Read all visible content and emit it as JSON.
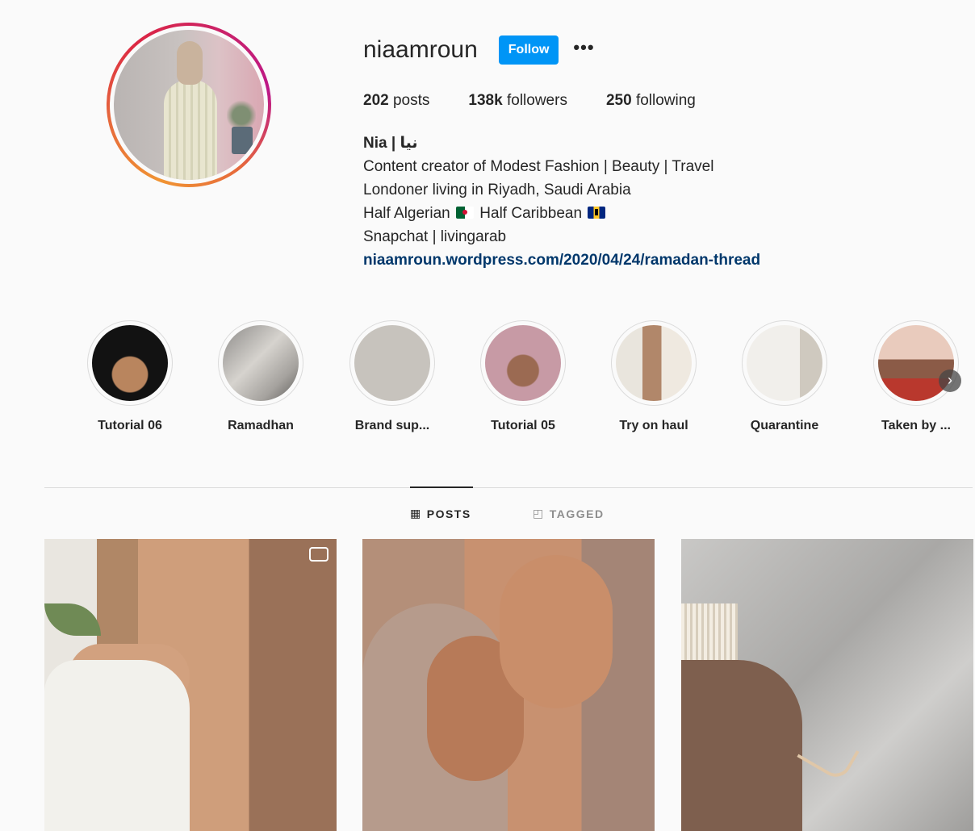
{
  "profile": {
    "username": "niaamroun",
    "follow_label": "Follow",
    "more_label": "•••",
    "stats": {
      "posts_count": "202",
      "posts_label": "posts",
      "followers_count": "138k",
      "followers_label": "followers",
      "following_count": "250",
      "following_label": "following"
    },
    "bio": {
      "name": "Nia | نيا",
      "line1": "Content creator of Modest Fashion | Beauty | Travel",
      "line2": "Londoner living in Riyadh, Saudi Arabia",
      "line3_a": "Half Algerian",
      "line3_b": "Half Caribbean",
      "line4": "Snapchat | livingarab",
      "link": "niaamroun.wordpress.com/2020/04/24/ramadan-thread"
    }
  },
  "highlights": [
    {
      "label": "Tutorial 06"
    },
    {
      "label": "Ramadhan"
    },
    {
      "label": "Brand sup..."
    },
    {
      "label": "Tutorial 05"
    },
    {
      "label": "Try on haul"
    },
    {
      "label": "Quarantine"
    },
    {
      "label": "Taken by ..."
    }
  ],
  "tabs": {
    "posts": "POSTS",
    "tagged": "TAGGED"
  },
  "icons": {
    "posts_tab": "grid-icon",
    "tagged_tab": "tagged-user-icon",
    "reel": "reel-icon",
    "highlights_next": "chevron-right-icon"
  },
  "colors": {
    "accent": "#0095f6",
    "link": "#00376b",
    "background": "#fafafa"
  }
}
